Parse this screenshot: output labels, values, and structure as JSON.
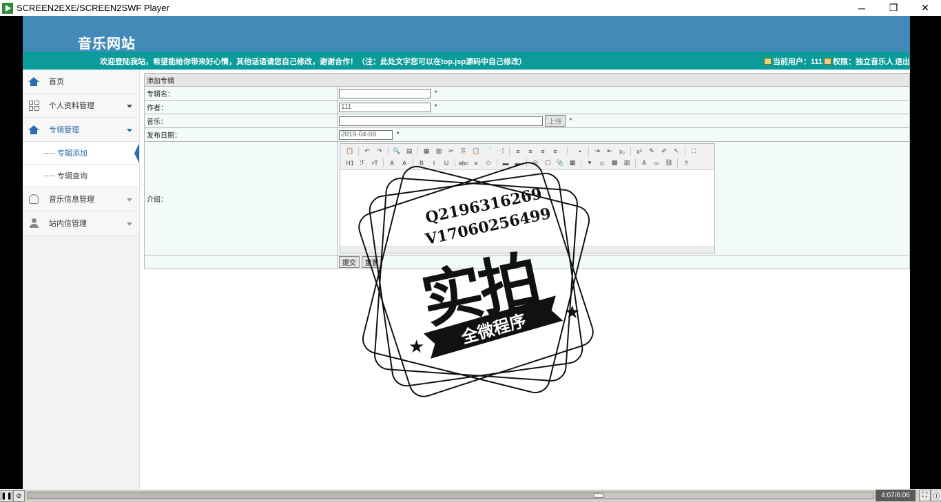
{
  "window": {
    "title": "SCREEN2EXE/SCREEN2SWF Player",
    "minimize": "─",
    "restore": "❐",
    "close": "✕"
  },
  "site": {
    "title": "音乐网站",
    "notice": "欢迎登陆我站，希望能给你带来好心情，其他话语请您自己修改，谢谢合作！（注：此处文字您可以在top.jsp源码中自己修改）",
    "current_user": "当前用户：111",
    "permission": "权限：独立音乐人",
    "logout": "退出"
  },
  "sidebar": {
    "items": [
      {
        "label": "首页",
        "icon": "home-icon"
      },
      {
        "label": "个人资料管理",
        "icon": "grid-icon"
      },
      {
        "label": "专辑管理",
        "icon": "home-icon"
      },
      {
        "label": "音乐信息管理",
        "icon": "users-icon"
      },
      {
        "label": "站内信管理",
        "icon": "user-icon"
      }
    ],
    "sub_items": [
      {
        "label": "专辑添加"
      },
      {
        "label": "专辑查询"
      }
    ]
  },
  "form": {
    "caption": "添加专辑",
    "album_name_label": "专辑名：",
    "album_name_value": "",
    "author_label": "作者：",
    "author_value": "111",
    "music_label": "音乐：",
    "music_value": "",
    "upload_label": "上传",
    "date_label": "发布日期：",
    "date_value": "2019-04-08",
    "intro_label": "介绍：",
    "required_mark": "*",
    "submit_label": "提交",
    "reset_label": "重置"
  },
  "editor": {
    "toolbar_row1": [
      "📋",
      "↶",
      "↷",
      "🔍",
      "▤",
      "▦",
      "▥",
      "✂",
      "⎘",
      "📋",
      "📄",
      "📑",
      "≡",
      "≡",
      "≡",
      "≡",
      "⋮",
      "•",
      "⇥",
      "⇤",
      "x₂",
      "x²",
      "✎",
      "✐",
      "↖",
      "⛶"
    ],
    "toolbar_row2": [
      "H1",
      "ℱ",
      "тT",
      "A",
      "A",
      "B",
      "I",
      "U",
      "abc",
      "≡",
      "◇",
      "▬",
      "▬",
      "◎",
      "▢",
      "📎",
      "▦",
      "▾",
      "☺",
      "▩",
      "▥",
      "⚓",
      "∞",
      "⛓",
      "?"
    ]
  },
  "watermark": {
    "line1": "Q2196316269",
    "line2": "V17060256499",
    "big": "实拍",
    "banner": "全微程序",
    "star": "★"
  },
  "player": {
    "time": "4:07/6:06",
    "progress": 0.675,
    "pause_icon": "❚❚",
    "loop_icon": "⊘",
    "fit_icon": "⛶",
    "info_icon": "ⓘ"
  }
}
